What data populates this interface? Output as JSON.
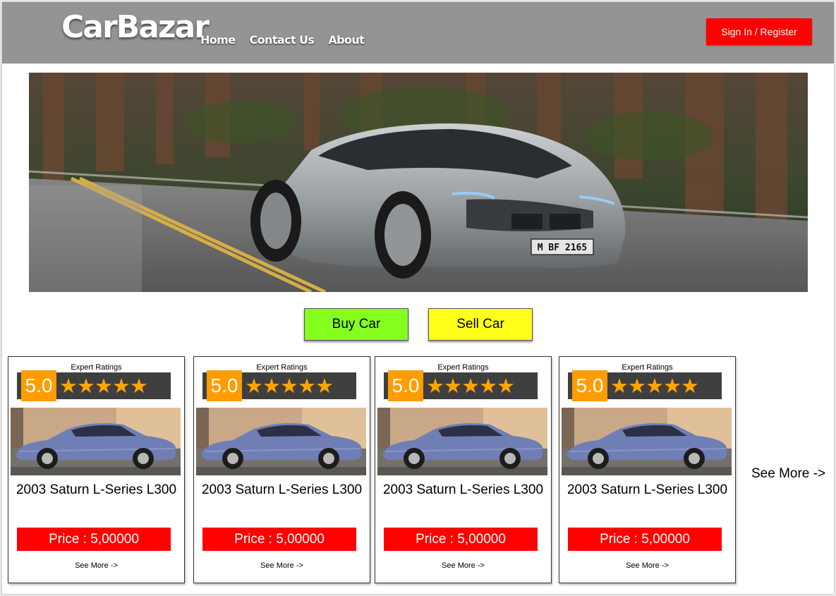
{
  "header": {
    "logo": "CarBazar",
    "nav": [
      "Home",
      "Contact Us",
      "About"
    ],
    "signin_label": "Sign In / Register",
    "colors": {
      "header_bg": "#949494",
      "signin_bg": "#ff0000"
    }
  },
  "hero": {
    "image": "silver-sports-car-on-forest-road",
    "plate": "M BF 2165"
  },
  "actions": {
    "buy_label": "Buy Car",
    "sell_label": "Sell Car",
    "colors": {
      "buy_bg": "#84ff1e",
      "sell_bg": "#ffff1a"
    }
  },
  "cards": [
    {
      "rating_label": "Expert Ratings",
      "score": "5.0",
      "stars": "★★★★★",
      "stars_value": 5,
      "name": "2003 Saturn L-Series L300",
      "price": "Price : 5,00000",
      "see_more": "See More ->"
    },
    {
      "rating_label": "Expert Ratings",
      "score": "5.0",
      "stars": "★★★★★",
      "stars_value": 5,
      "name": "2003 Saturn L-Series L300",
      "price": "Price : 5,00000",
      "see_more": "See More ->"
    },
    {
      "rating_label": "Expert Ratings",
      "score": "5.0",
      "stars": "★★★★★",
      "stars_value": 5,
      "name": "2003 Saturn L-Series L300",
      "price": "Price : 5,00000",
      "see_more": "See More ->"
    },
    {
      "rating_label": "Expert Ratings",
      "score": "5.0",
      "stars": "★★★★★",
      "stars_value": 5,
      "name": "2003 Saturn L-Series L300",
      "price": "Price : 5,00000",
      "see_more": "See More ->"
    }
  ],
  "see_more_main": "See More ->",
  "card_colors": {
    "score_bg": "#ff9d00",
    "star_color": "#ffa500",
    "rating_bar_bg": "#3f3f3f",
    "price_bg": "#ff0000"
  }
}
